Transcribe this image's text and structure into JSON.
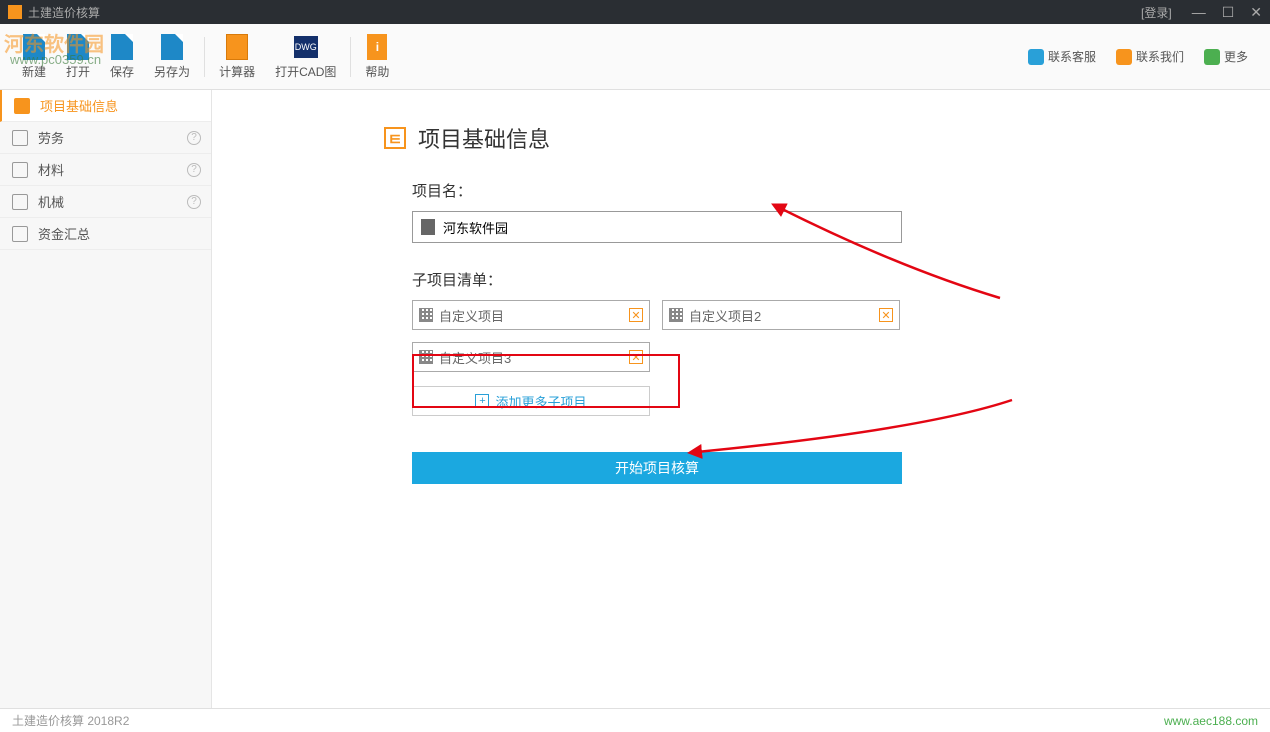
{
  "titlebar": {
    "title": "土建造价核算",
    "login": "登录"
  },
  "toolbar": {
    "items": [
      {
        "label": "新建"
      },
      {
        "label": "打开"
      },
      {
        "label": "保存"
      },
      {
        "label": "另存为"
      },
      {
        "label": "计算器"
      },
      {
        "label": "打开CAD图"
      },
      {
        "label": "帮助"
      }
    ],
    "right": [
      {
        "label": "联系客服"
      },
      {
        "label": "联系我们"
      },
      {
        "label": "更多"
      }
    ]
  },
  "sidebar": {
    "items": [
      {
        "label": "项目基础信息",
        "active": true
      },
      {
        "label": "劳务"
      },
      {
        "label": "材料"
      },
      {
        "label": "机械"
      },
      {
        "label": "资金汇总"
      }
    ]
  },
  "form": {
    "page_title": "项目基础信息",
    "name_label": "项目名：",
    "name_value": "河东软件园",
    "sublist_label": "子项目清单：",
    "sub_items": [
      {
        "label": "自定义项目"
      },
      {
        "label": "自定义项目2"
      },
      {
        "label": "自定义项目3"
      }
    ],
    "add_label": "添加更多子项目",
    "start_label": "开始项目核算"
  },
  "statusbar": {
    "left": "土建造价核算 2018R2",
    "right": "www.aec188.com"
  },
  "watermark": {
    "main": "河东软件园",
    "sub": "www.pc0359.cn"
  }
}
